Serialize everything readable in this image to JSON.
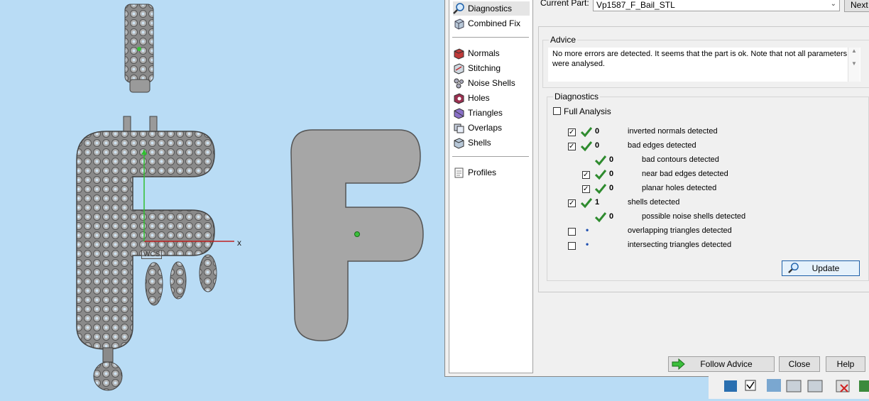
{
  "viewport": {
    "axis_x_label": "x",
    "wcs_label": "WCS"
  },
  "nav": {
    "items": [
      {
        "label": "Diagnostics",
        "icon": "magnifier-icon"
      },
      {
        "label": "Combined Fix",
        "icon": "cube-icon"
      },
      {
        "label": "Normals",
        "icon": "normals-icon"
      },
      {
        "label": "Stitching",
        "icon": "stitching-icon"
      },
      {
        "label": "Noise Shells",
        "icon": "noise-shells-icon"
      },
      {
        "label": "Holes",
        "icon": "holes-icon"
      },
      {
        "label": "Triangles",
        "icon": "triangles-icon"
      },
      {
        "label": "Overlaps",
        "icon": "overlaps-icon"
      },
      {
        "label": "Shells",
        "icon": "shells-icon"
      },
      {
        "label": "Profiles",
        "icon": "profiles-icon"
      }
    ]
  },
  "header": {
    "current_part_label": "Current Part:",
    "current_part_value": "Vp1587_F_Bail_STL",
    "next_label": "Next"
  },
  "advice": {
    "title": "Advice",
    "text": "No more errors are detected. It seems that the part is ok. Note that not all parameters were analysed."
  },
  "diagnostics": {
    "title": "Diagnostics",
    "full_analysis_label": "Full Analysis",
    "rows": [
      {
        "count": "0",
        "label": "inverted normals detected"
      },
      {
        "count": "0",
        "label": "bad edges detected"
      },
      {
        "count": "0",
        "label": "bad contours detected"
      },
      {
        "count": "0",
        "label": "near bad edges detected"
      },
      {
        "count": "0",
        "label": "planar holes detected"
      },
      {
        "count": "1",
        "label": "shells detected"
      },
      {
        "count": "0",
        "label": "possible noise shells detected"
      },
      {
        "count": "",
        "label": "overlapping triangles detected"
      },
      {
        "count": "",
        "label": "intersecting triangles detected"
      }
    ],
    "update_label": "Update"
  },
  "footer": {
    "follow_advice_label": "Follow Advice",
    "close_label": "Close",
    "help_label": "Help"
  },
  "colors": {
    "viewport_bg": "#b9dcf5",
    "model_grey": "#a6a6a6",
    "tick_green": "#2e8b2e",
    "accent_blue": "#1c5fa8"
  }
}
